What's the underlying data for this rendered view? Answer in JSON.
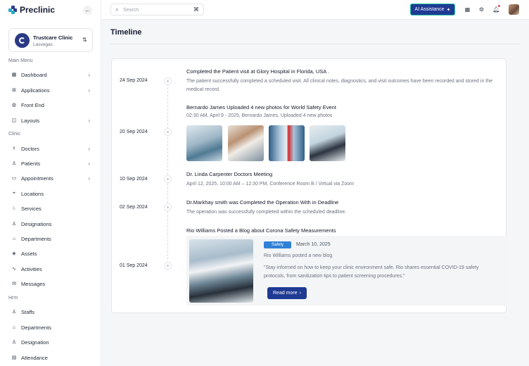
{
  "brand": {
    "name": "Preclinic"
  },
  "clinic": {
    "name": "Trustcare Clinic",
    "location": "Lasvegas"
  },
  "sidebar": {
    "sections": [
      {
        "label": "Main Menu",
        "items": [
          {
            "label": "Dashboard",
            "icon": "dashboard-icon",
            "has_submenu": true
          },
          {
            "label": "Applications",
            "icon": "applications-icon",
            "has_submenu": true
          },
          {
            "label": "Front End",
            "icon": "globe-icon",
            "has_submenu": false
          },
          {
            "label": "Layouts",
            "icon": "layouts-icon",
            "has_submenu": true
          }
        ]
      },
      {
        "label": "Clinic",
        "items": [
          {
            "label": "Doctors",
            "icon": "doctor-icon",
            "has_submenu": true
          },
          {
            "label": "Patients",
            "icon": "patient-icon",
            "has_submenu": true
          },
          {
            "label": "Appointments",
            "icon": "calendar-icon",
            "has_submenu": true
          },
          {
            "label": "Locations",
            "icon": "location-pin-icon",
            "has_submenu": false
          },
          {
            "label": "Services",
            "icon": "services-icon",
            "has_submenu": false
          },
          {
            "label": "Designations",
            "icon": "designation-icon",
            "has_submenu": false
          },
          {
            "label": "Departments",
            "icon": "department-icon",
            "has_submenu": false
          },
          {
            "label": "Assets",
            "icon": "assets-icon",
            "has_submenu": false
          },
          {
            "label": "Activities",
            "icon": "activity-icon",
            "has_submenu": false
          },
          {
            "label": "Messages",
            "icon": "messages-icon",
            "has_submenu": false
          }
        ]
      },
      {
        "label": "Hrm",
        "items": [
          {
            "label": "Staffs",
            "icon": "staff-icon",
            "has_submenu": false
          },
          {
            "label": "Departments",
            "icon": "department-icon",
            "has_submenu": false
          },
          {
            "label": "Designation",
            "icon": "designation-icon",
            "has_submenu": false
          },
          {
            "label": "Attendance",
            "icon": "attendance-icon",
            "has_submenu": false
          }
        ]
      }
    ]
  },
  "topbar": {
    "search_placeholder": "Search",
    "ai_button_label": "AI Assistance",
    "accent_color": "#1f3a93"
  },
  "page": {
    "title": "Timeline"
  },
  "timeline": [
    {
      "date": "24 Sep 2024",
      "title": "Completed the Patient visit at Glory Hospital in Florida, USA .",
      "text": "The patient successfully completed a scheduled visit. All clinical notes, diagnostics, and visit outcomes have been recorded and stored in the medical record."
    },
    {
      "date": "20 Sep 2024",
      "title": "Bernardo James Uploaded 4 new photos for World Safety Event",
      "text": "02:30 AM, April 9 - 2025, Bernardo James, Uploaded 4 new photos"
    },
    {
      "date": "10 Sep 2024",
      "title": "Dr. Linda Carpenter Doctors Meeting",
      "text": "April 12, 2025, 10:00 AM – 12:30 PM, Conference Room B / Virtual via Zoom"
    },
    {
      "date": "02 Sep 2024",
      "title": "Dr.Markhay smith was Completed the Operation With in Deadline",
      "text": "The operation was successfully completed within the scheduled deadline."
    },
    {
      "date": "01 Sep 2024",
      "title": "Rio Williams Posted a Blog about Corona Safety Measurements",
      "blog": {
        "tag": "Safety",
        "date": "March 10, 2025",
        "author_line": "Rio Williams posted a new blog",
        "quote": "\"Stay informed on how to keep your clinic environment safe. Rio shares essential COVID-19 safety protocols, from sanitization tips to patient screening procedures.\"",
        "read_more_label": "Read more"
      }
    }
  ]
}
